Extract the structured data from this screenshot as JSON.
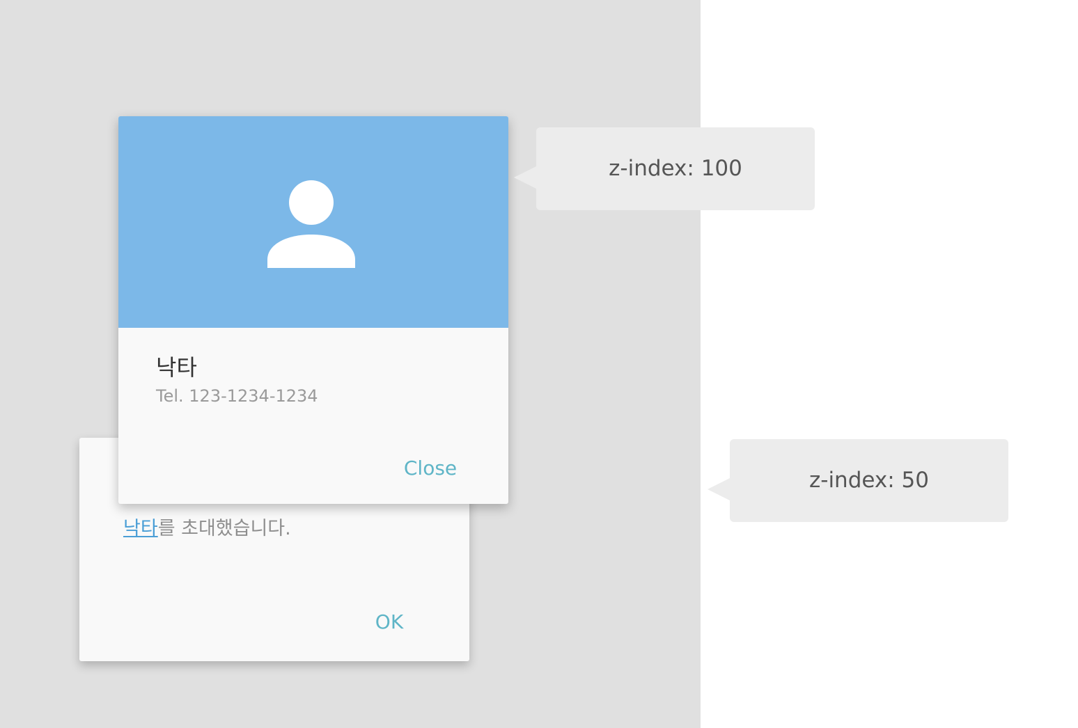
{
  "front_dialog": {
    "name": "낙타",
    "tel": "Tel. 123-1234-1234",
    "close_label": "Close",
    "header_color": "#7cb8e8",
    "avatar_icon": "person-icon"
  },
  "back_dialog": {
    "link_text": "낙타",
    "message_rest": "를 초대했습니다.",
    "ok_label": "OK"
  },
  "callouts": {
    "front": "z-index: 100",
    "back": "z-index: 50"
  },
  "colors": {
    "accent_button": "#5fb5c7",
    "link": "#4a9ed6",
    "backdrop": "#e0e0e0"
  }
}
